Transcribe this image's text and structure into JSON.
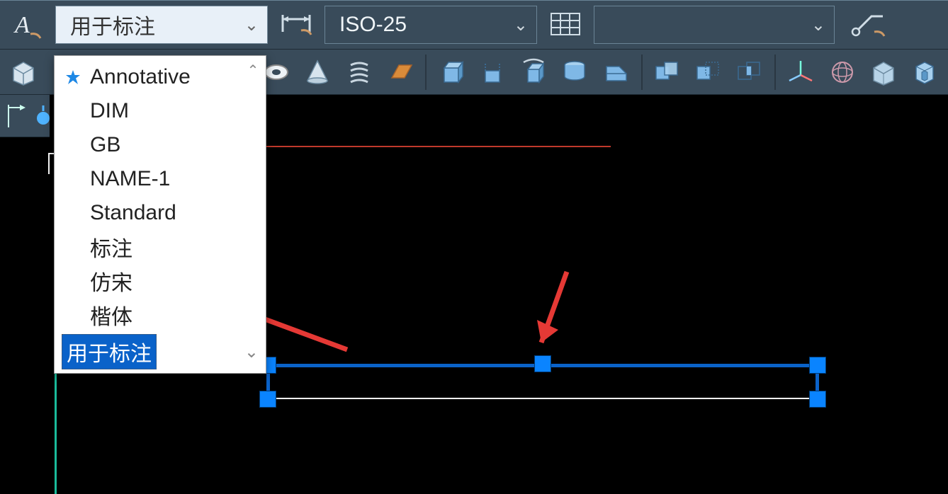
{
  "toolbar": {
    "text_style_icon": "text-style",
    "style_combo": {
      "value": "用于标注"
    },
    "dim_icon": "dim-style",
    "dim_combo": {
      "value": "ISO-25"
    },
    "table_icon": "table-style",
    "wide_combo": {
      "value": ""
    },
    "mleader_icon": "mleader-style"
  },
  "dropdown": {
    "items": [
      {
        "label": "Annotative",
        "annotative": true
      },
      {
        "label": "DIM",
        "annotative": false
      },
      {
        "label": "GB",
        "annotative": false
      },
      {
        "label": "NAME-1",
        "annotative": false
      },
      {
        "label": "Standard",
        "annotative": false
      },
      {
        "label": "标注",
        "annotative": false
      },
      {
        "label": "仿宋",
        "annotative": false
      },
      {
        "label": "楷体",
        "annotative": false
      }
    ],
    "editing": "用于标注"
  },
  "icons_row2": [
    "box-icon",
    "pyramid-icon",
    "torus-icon",
    "cone-icon",
    "coil-icon",
    "plane-icon",
    "extrude-icon",
    "loft-icon",
    "revolve-icon",
    "sweep-icon",
    "wedge-icon",
    "union-icon",
    "subtract-icon",
    "intersect-icon",
    "ucs-icon",
    "globe-icon",
    "box3d-icon",
    "cylinder3d-icon"
  ],
  "icons_row3": [
    "expand-icon",
    "light-icon"
  ],
  "colors": {
    "toolbar_bg": "#394b5a",
    "accent_blue": "#0a84ff",
    "grip_blue": "#0a62c9",
    "arrow_red": "#e53935"
  }
}
